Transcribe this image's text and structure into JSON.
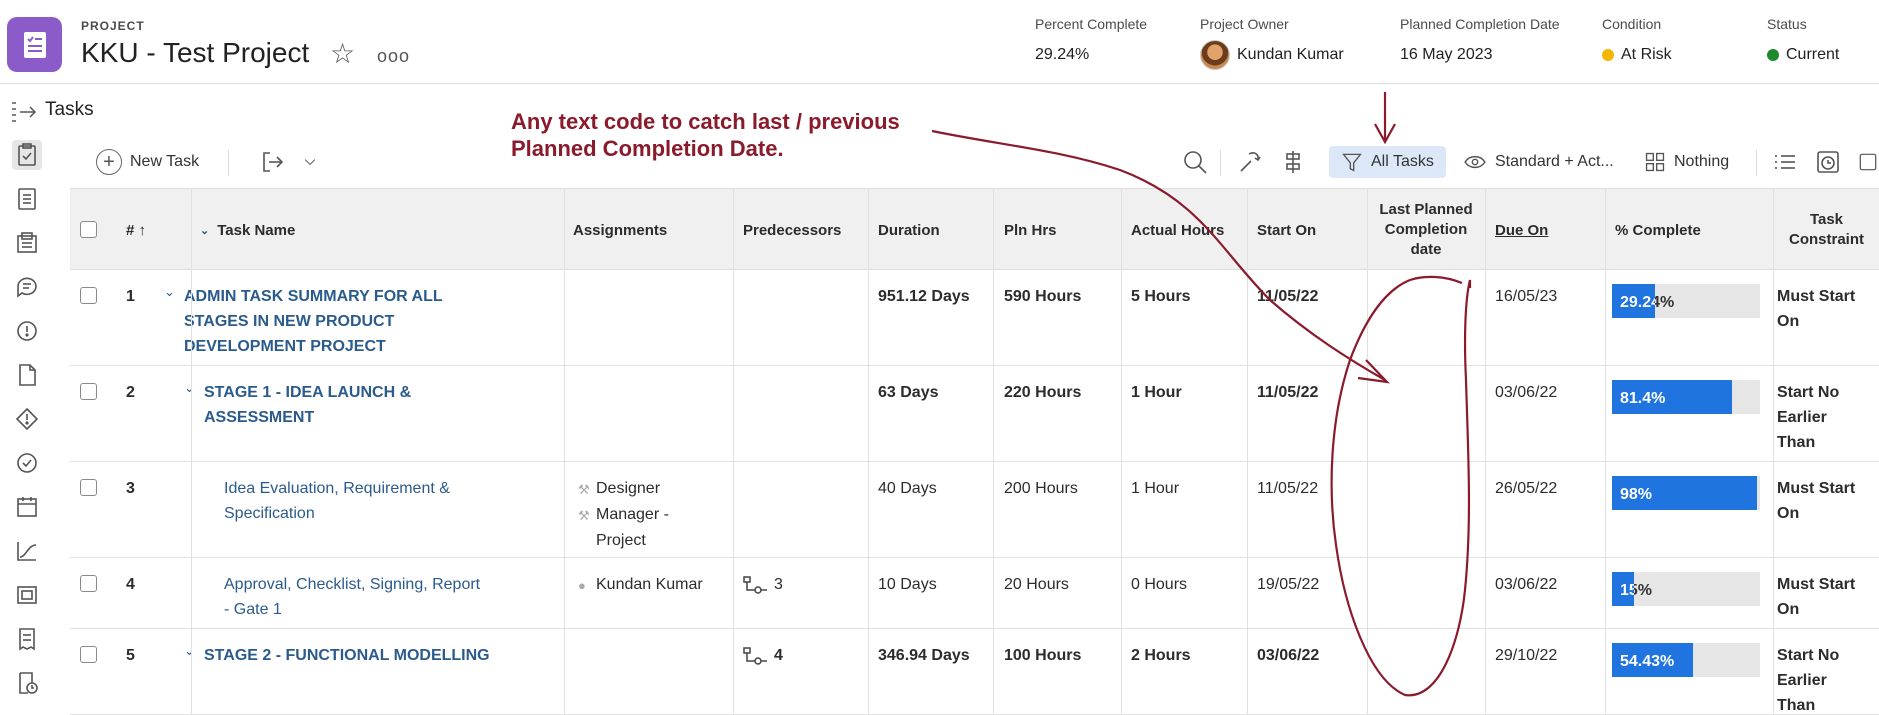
{
  "header": {
    "project_label": "PROJECT",
    "project_title": "KKU - Test Project",
    "more_label": "ooo",
    "meta": [
      {
        "label": "Percent Complete",
        "value": "29.24%"
      },
      {
        "label": "Project Owner",
        "value": "Kundan Kumar"
      },
      {
        "label": "Planned Completion Date",
        "value": "16 May 2023"
      },
      {
        "label": "Condition",
        "value": "At Risk",
        "color": "#f2b705"
      },
      {
        "label": "Status",
        "value": "Current",
        "color": "#1e8a2e"
      }
    ]
  },
  "tasks_label": "Tasks",
  "toolbar": {
    "new_task": "New Task",
    "filter": "All Tasks",
    "view": "Standard + Act...",
    "grouping": "Nothing"
  },
  "columns": {
    "num": "#",
    "task_name": "Task Name",
    "assignments": "Assignments",
    "predecessors": "Predecessors",
    "duration": "Duration",
    "pln_hrs": "Pln Hrs",
    "actual_hours": "Actual Hours",
    "start_on": "Start On",
    "last_planned_line1": "Last Planned",
    "last_planned_line2": "Completion",
    "last_planned_line3": "date",
    "due_on": "Due On",
    "pct_complete": "% Complete",
    "constraint_line1": "Task",
    "constraint_line2": "Constraint"
  },
  "rows": [
    {
      "num": "1",
      "name_lines": [
        "ADMIN TASK SUMMARY FOR ALL",
        "STAGES IN NEW PRODUCT",
        "DEVELOPMENT PROJECT"
      ],
      "summary": true,
      "indent": 0,
      "assign": [],
      "pred": "",
      "duration": "951.12 Days",
      "pln": "590 Hours",
      "actual": "5 Hours",
      "start": "11/05/22",
      "last_planned": "",
      "due": "16/05/23",
      "pct_label": "29.24%",
      "pct": 0.2924,
      "constraint_lines": [
        "Must Start",
        "On"
      ]
    },
    {
      "num": "2",
      "name_lines": [
        "STAGE 1 - IDEA LAUNCH &",
        "ASSESSMENT"
      ],
      "summary": true,
      "indent": 1,
      "assign": [],
      "pred": "",
      "duration": "63 Days",
      "pln": "220 Hours",
      "actual": "1 Hour",
      "start": "11/05/22",
      "last_planned": "",
      "due": "03/06/22",
      "pct_label": "81.4%",
      "pct": 0.814,
      "constraint_lines": [
        "Start No",
        "Earlier",
        "Than"
      ]
    },
    {
      "num": "3",
      "name_lines": [
        "Idea Evaluation, Requirement &",
        "Specification"
      ],
      "summary": false,
      "indent": 2,
      "assign": [
        "Designer",
        "Manager -",
        "Project"
      ],
      "pred": "",
      "duration": "40 Days",
      "pln": "200 Hours",
      "actual": "1 Hour",
      "start": "11/05/22",
      "last_planned": "",
      "due": "26/05/22",
      "pct_label": "98%",
      "pct": 0.98,
      "constraint_lines": [
        "Must Start",
        "On"
      ]
    },
    {
      "num": "4",
      "name_lines": [
        "Approval, Checklist, Signing, Report",
        "- Gate 1"
      ],
      "summary": false,
      "indent": 2,
      "assign": [
        "Kundan Kumar"
      ],
      "pred": "3",
      "duration": "10 Days",
      "pln": "20 Hours",
      "actual": "0 Hours",
      "start": "19/05/22",
      "last_planned": "",
      "due": "03/06/22",
      "pct_label": "15%",
      "pct": 0.15,
      "constraint_lines": [
        "Must Start",
        "On"
      ]
    },
    {
      "num": "5",
      "name_lines": [
        "STAGE 2 - FUNCTIONAL MODELLING"
      ],
      "summary": true,
      "indent": 1,
      "assign": [],
      "pred": "4",
      "duration": "346.94 Days",
      "pln": "100 Hours",
      "actual": "2 Hours",
      "start": "03/06/22",
      "last_planned": "",
      "due": "29/10/22",
      "pct_label": "54.43%",
      "pct": 0.5443,
      "constraint_lines": [
        "Start No",
        "Earlier",
        "Than"
      ]
    }
  ],
  "annotation": {
    "line1": "Any text code to catch last / previous",
    "line2": "Planned Completion Date.",
    "color": "#8a1b2c"
  },
  "colors": {
    "progress": "#1f74e0",
    "task_link": "#2b5b8c",
    "filter_bg": "#dce8f7",
    "project_icon": "#8b5cc9"
  }
}
